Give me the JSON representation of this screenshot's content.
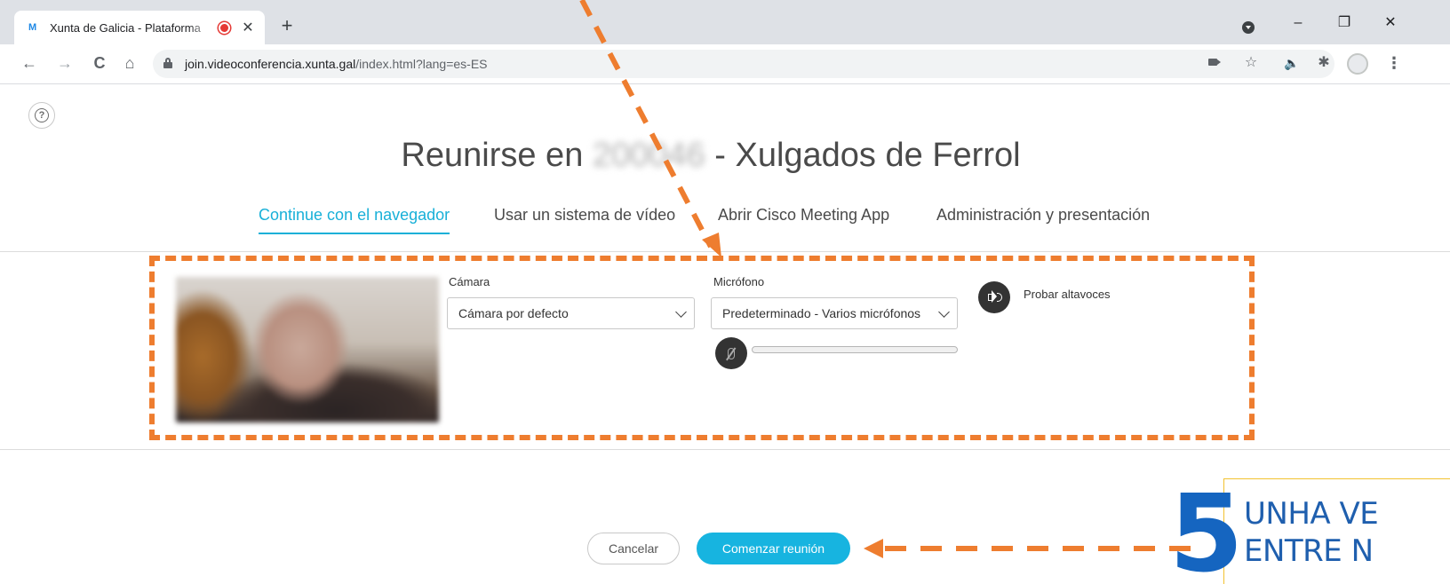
{
  "browser": {
    "tab_title": "Xunta de Galicia - Plataforma",
    "tab_favicon": "M",
    "new_tab_label": "+",
    "close_tab_glyph": "✕",
    "url_host": "join.videoconferencia.xunta.gal",
    "url_path": "/index.html?lang=es-ES",
    "window_controls": {
      "minimize": "–",
      "maximize": "❐",
      "close": "✕"
    },
    "nav": {
      "back": "←",
      "forward": "→",
      "reload": "C",
      "home": "⌂"
    },
    "toolbar_icons": {
      "star": "☆",
      "audio": "🔈",
      "extensions": "✱",
      "menu": "⋮"
    }
  },
  "page": {
    "help_glyph": "?",
    "title_prefix": "Reunirse en",
    "title_redacted": "200046",
    "title_suffix": "- Xulgados de Ferrol",
    "tabs": [
      {
        "label": "Continue con el navegador",
        "active": true
      },
      {
        "label": "Usar un sistema de vídeo",
        "active": false
      },
      {
        "label": "Abrir Cisco Meeting App",
        "active": false
      },
      {
        "label": "Administración y presentación",
        "active": false
      }
    ],
    "camera": {
      "label": "Cámara",
      "selected": "Cámara por defecto"
    },
    "microphone": {
      "label": "Micrófono",
      "selected": "Predeterminado - Varios micrófonos",
      "level": 0
    },
    "speaker": {
      "label": "Probar altavoces"
    },
    "buttons": {
      "cancel": "Cancelar",
      "start": "Comenzar reunión"
    }
  },
  "annotation": {
    "step_number": "5",
    "text_line1": "UNHA VE",
    "text_line2": "ENTRE N",
    "accent_color": "#ee7d2f",
    "callout_color": "#1f5fae"
  },
  "colors": {
    "primary": "#17b4e0",
    "active_tab": "#18b0d8",
    "chrome_bg": "#dee1e6"
  }
}
